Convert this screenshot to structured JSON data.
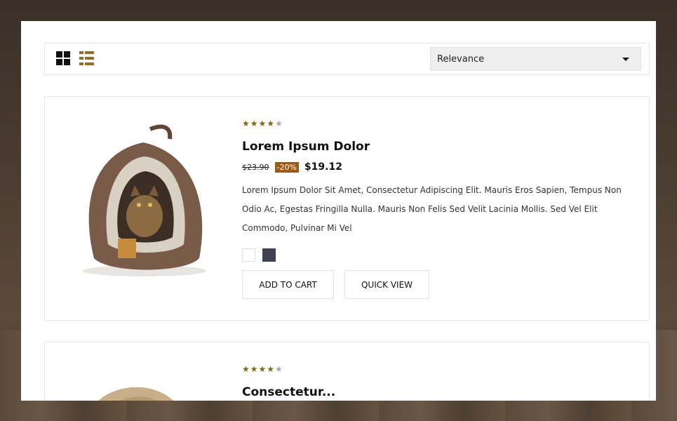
{
  "toolbar": {
    "sort": {
      "selected": "Relevance"
    }
  },
  "colors": {
    "star_on": "#7a6a10",
    "star_off": "#a8a8a8",
    "discount_bg": "#9b5a1a",
    "list_icon": "#9a6a2a",
    "swatch_dark": "#3e4250",
    "swatch_white": "#ffffff"
  },
  "products": [
    {
      "rating": 4,
      "rating_max": 5,
      "title": "Lorem Ipsum Dolor",
      "old_price": "$23.90",
      "discount": "-20%",
      "price": "$19.12",
      "description": "Lorem Ipsum Dolor Sit Amet, Consectetur Adipiscing Elit. Mauris Eros Sapien, Tempus Non Odio Ac, Egestas Fringilla Nulla. Mauris Non Felis Sed Velit Lacinia Mollis. Sed Vel Elit Commodo, Pulvinar Mi Vel",
      "add_to_cart_label": "ADD TO CART",
      "quick_view_label": "QUICK VIEW"
    },
    {
      "rating": 4,
      "rating_max": 5,
      "title": "Consectetur..."
    }
  ]
}
